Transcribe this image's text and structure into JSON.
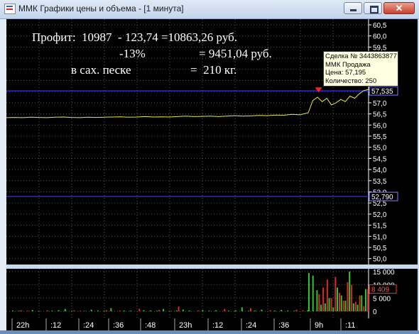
{
  "window": {
    "title": "ММК Графики цены и объема - [1 минута]",
    "close_glyph": "✕"
  },
  "overlay": {
    "line1": "Профит:  10987  - 123,74 =10863,26 руб.",
    "line2": "-13%",
    "line2b": "= 9451,04 руб.",
    "line3": "в сах. песке",
    "line3b": "=  210 кг."
  },
  "tooltip": {
    "line1": "Сделка № 3443863877",
    "line2": "ММК Продажа",
    "line3": "Цена: 57,195",
    "line4": "Количество: 250"
  },
  "price_axis": {
    "ticks": [
      "60,5",
      "60,0",
      "59,5",
      "59,0",
      "58,5",
      "58,0",
      "57,5",
      "57,0",
      "56,5",
      "56,0",
      "55,5",
      "55,0",
      "54,5",
      "54,0",
      "53,5",
      "53,0",
      "52,5",
      "52,0",
      "51,5",
      "51,0",
      "50,5",
      "50,0"
    ],
    "marker_high": "57,535",
    "marker_low": "52,790"
  },
  "volume_axis": {
    "ticks": [
      "15 000",
      "10 000",
      "5 000",
      "0"
    ],
    "marker": "8 409"
  },
  "time_axis": {
    "labels": [
      "22h",
      ":12",
      ":24",
      ":36",
      ":48",
      "23h",
      ":12",
      ":24",
      ":36",
      "9h",
      ":11"
    ]
  },
  "colors": {
    "background": "#000000",
    "price_line": "#e8e84a",
    "level_line": "#2a2ac8",
    "grid": "#5a5a5a",
    "volume_up": "#2ec32e",
    "volume_down": "#d42a2a",
    "axis_text": "#ffffff"
  },
  "chart_data": [
    {
      "type": "line",
      "title": "",
      "series": [
        {
          "values": [
            56.33,
            56.34,
            56.33,
            56.35,
            56.34,
            56.33,
            56.35,
            56.36,
            56.34,
            56.33,
            56.35,
            56.34,
            56.35,
            56.36,
            56.37,
            56.35,
            56.36,
            56.38,
            56.36,
            56.37,
            56.36,
            56.38,
            56.4,
            56.38,
            56.39,
            56.4,
            56.38,
            56.4,
            56.42,
            56.4,
            56.41,
            56.43,
            56.42,
            56.45,
            56.44,
            56.48,
            56.46,
            56.55,
            57.1,
            57.25,
            57.05,
            57.2,
            56.9,
            57.0,
            57.15,
            57.05,
            57.3,
            57.2,
            57.4,
            57.55,
            57.6
          ]
        }
      ],
      "levels": [
        57.535,
        52.79
      ],
      "ylim": [
        50.0,
        60.5
      ]
    },
    {
      "type": "bar",
      "title": "",
      "ylim": [
        0,
        15000
      ],
      "series": [
        {
          "name": "buy",
          "values": [
            300,
            200,
            0,
            500,
            150,
            0,
            250,
            400,
            900,
            200,
            0,
            150,
            600,
            300,
            200,
            1200,
            0,
            300,
            250,
            0,
            400,
            350,
            200,
            900,
            150,
            300,
            700,
            250,
            0,
            500,
            200,
            350,
            0,
            250,
            400,
            1500,
            200,
            300,
            600,
            0,
            250,
            500,
            300,
            200,
            0,
            350,
            14500,
            13500,
            8000,
            2500,
            3000,
            5000,
            1500,
            9000,
            6000,
            4000,
            15000,
            3000,
            2500,
            6000,
            8409
          ]
        },
        {
          "name": "sell",
          "values": [
            0,
            400,
            250,
            0,
            0,
            300,
            0,
            0,
            0,
            350,
            200,
            0,
            0,
            0,
            450,
            0,
            300,
            0,
            0,
            1000,
            0,
            0,
            500,
            0,
            0,
            1800,
            0,
            0,
            300,
            0,
            0,
            0,
            900,
            0,
            0,
            0,
            1200,
            0,
            0,
            400,
            0,
            0,
            0,
            600,
            300,
            0,
            0,
            0,
            6500,
            9000,
            12000,
            5000,
            13000,
            7000,
            4000,
            11000,
            10000,
            3500,
            6000,
            2000,
            8409
          ]
        }
      ]
    }
  ]
}
